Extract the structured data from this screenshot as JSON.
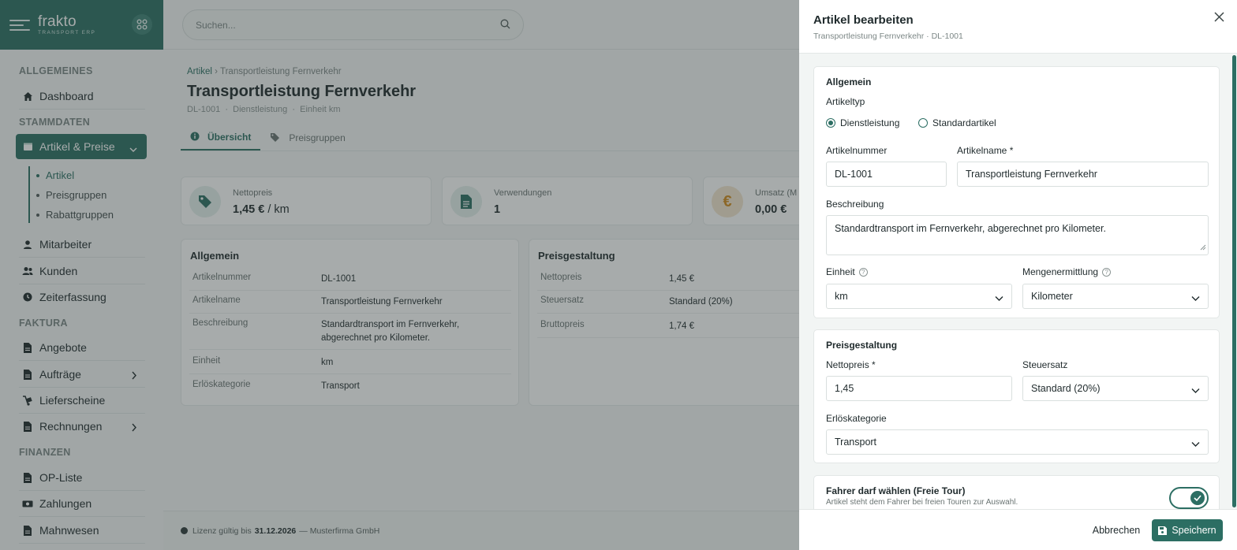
{
  "brand": {
    "name": "frakto",
    "tagline": "TRANSPORT ERP"
  },
  "search": {
    "placeholder": "Suchen..."
  },
  "sidebar": {
    "sections": {
      "allgemeines": "ALLGEMEINES",
      "stammdaten": "STAMMDATEN",
      "faktura": "FAKTURA",
      "finanzen": "FINANZEN"
    },
    "items": {
      "dashboard": "Dashboard",
      "artikel_preise": "Artikel & Preise",
      "mitarbeiter": "Mitarbeiter",
      "kunden": "Kunden",
      "zeiterfassung": "Zeiterfassung",
      "angebote": "Angebote",
      "auftraege": "Aufträge",
      "lieferscheine": "Lieferscheine",
      "rechnungen": "Rechnungen",
      "op_liste": "OP-Liste",
      "zahlungen": "Zahlungen",
      "mahnwesen": "Mahnwesen"
    },
    "subitems": {
      "artikel": "Artikel",
      "preisgruppen": "Preisgruppen",
      "rabattgruppen": "Rabattgruppen"
    }
  },
  "page": {
    "breadcrumb_root": "Artikel",
    "breadcrumb_sep": "›",
    "breadcrumb_current": "Transportleistung Fernverkehr",
    "title": "Transportleistung Fernverkehr",
    "meta": {
      "number": "DL-1001",
      "type": "Dienstleistung",
      "unit": "Einheit km",
      "sep": "·"
    },
    "tabs": {
      "overview": "Übersicht",
      "pricegroups": "Preisgruppen"
    }
  },
  "stats": {
    "net": {
      "label": "Nettopreis",
      "value": "1,45 €",
      "unit": "/ km"
    },
    "usage": {
      "label": "Verwendungen",
      "value": "1"
    },
    "revenue": {
      "label": "Umsatz (M",
      "value": "0,00 €"
    }
  },
  "card_general": {
    "title": "Allgemein",
    "rows": [
      {
        "k": "Artikelnummer",
        "v": "DL-1001"
      },
      {
        "k": "Artikelname",
        "v": "Transportleistung Fernverkehr"
      },
      {
        "k": "Beschreibung",
        "v": "Standardtransport im Fernverkehr, abgerechnet pro Kilometer."
      },
      {
        "k": "Einheit",
        "v": "km"
      },
      {
        "k": "Erlöskategorie",
        "v": "Transport"
      }
    ]
  },
  "card_price": {
    "title": "Preisgestaltung",
    "rows": [
      {
        "k": "Nettopreis",
        "v": "1,45 €"
      },
      {
        "k": "Steuersatz",
        "v": "Standard (20%)"
      },
      {
        "k": "Bruttopreis",
        "v": "1,74 €"
      }
    ]
  },
  "footer": {
    "prefix": "Lizenz gültig bis",
    "date": "31.12.2026",
    "company": "— Musterfirma GmbH"
  },
  "drawer": {
    "title": "Artikel bearbeiten",
    "subtitle": "Transportleistung Fernverkehr · DL-1001",
    "general": {
      "heading": "Allgemein",
      "type_label": "Artikeltyp",
      "type_options": [
        "Dienstleistung",
        "Standardartikel"
      ],
      "type_selected": "Dienstleistung",
      "number_label": "Artikelnummer",
      "number_value": "DL-1001",
      "name_label": "Artikelname *",
      "name_value": "Transportleistung Fernverkehr",
      "desc_label": "Beschreibung",
      "desc_value": "Standardtransport im Fernverkehr, abgerechnet pro Kilometer.",
      "unit_label": "Einheit",
      "unit_value": "km",
      "qty_label": "Mengenermittlung",
      "qty_value": "Kilometer",
      "help_glyph": "?"
    },
    "pricing": {
      "heading": "Preisgestaltung",
      "net_label": "Nettopreis *",
      "net_value": "1,45",
      "tax_label": "Steuersatz",
      "tax_value": "Standard (20%)",
      "rev_label": "Erlöskategorie",
      "rev_value": "Transport"
    },
    "driver": {
      "title": "Fahrer darf wählen (Freie Tour)",
      "desc": "Artikel steht dem Fahrer bei freien Touren zur Auswahl.",
      "enabled": true
    },
    "buttons": {
      "cancel": "Abbrechen",
      "save": "Speichern"
    }
  },
  "colors": {
    "primary": "#2c6e63",
    "overlay": "rgba(45,55,55,0.42)",
    "coin": "#d08a1c"
  }
}
